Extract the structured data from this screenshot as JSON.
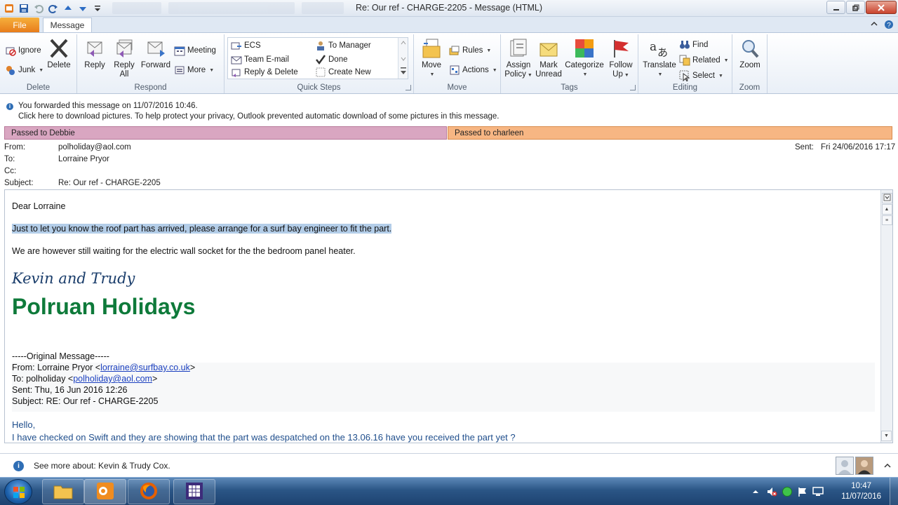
{
  "window": {
    "title": "Re: Our ref - CHARGE-2205  -  Message (HTML)"
  },
  "tabs": {
    "file": "File",
    "message": "Message"
  },
  "ribbon": {
    "delete_group": {
      "label": "Delete",
      "ignore": "Ignore",
      "junk": "Junk",
      "delete": "Delete"
    },
    "respond_group": {
      "label": "Respond",
      "reply": "Reply",
      "reply_all_1": "Reply",
      "reply_all_2": "All",
      "forward": "Forward",
      "meeting": "Meeting",
      "more": "More"
    },
    "quicksteps_group": {
      "label": "Quick Steps",
      "items": [
        "ECS",
        "To Manager",
        "Team E-mail",
        "Done",
        "Reply & Delete",
        "Create New"
      ]
    },
    "move_group": {
      "label": "Move",
      "move": "Move",
      "rules": "Rules",
      "actions": "Actions"
    },
    "tags_group": {
      "label": "Tags",
      "assign_policy_1": "Assign",
      "assign_policy_2": "Policy",
      "mark_unread_1": "Mark",
      "mark_unread_2": "Unread",
      "categorize": "Categorize",
      "follow_up_1": "Follow",
      "follow_up_2": "Up"
    },
    "editing_group": {
      "label": "Editing",
      "translate": "Translate",
      "find": "Find",
      "related": "Related",
      "select": "Select"
    },
    "zoom_group": {
      "label": "Zoom",
      "zoom": "Zoom"
    }
  },
  "info": {
    "forwarded": "You forwarded this message on 11/07/2016 10:46.",
    "pictures": "Click here to download pictures. To help protect your privacy, Outlook prevented automatic download of some pictures in this message."
  },
  "categories": [
    {
      "label": "Passed to Debbie",
      "color": "#d9a6c1"
    },
    {
      "label": "Passed to charleen",
      "color": "#f7b683"
    }
  ],
  "headers": {
    "from_label": "From:",
    "from": "polholiday@aol.com",
    "to_label": "To:",
    "to": "Lorraine Pryor",
    "cc_label": "Cc:",
    "cc": "",
    "subject_label": "Subject:",
    "subject": "Re: Our ref - CHARGE-2205",
    "sent_label": "Sent:",
    "sent": "Fri 24/06/2016 17:17"
  },
  "body": {
    "greeting": "Dear Lorraine",
    "line1": "Just to let you know the roof part has arrived, please arrange for a surf bay engineer to fit the part. ",
    "line2": "We are however still waiting for the electric wall socket for the the bedroom panel heater.",
    "sig_names": "Kevin and Trudy",
    "sig_company": "Polruan Holidays",
    "original_header": "-----Original Message-----",
    "orig_from_prefix": "From: Lorraine Pryor <",
    "orig_from_email": "lorraine@surfbay.co.uk",
    "orig_from_suffix": ">",
    "orig_to_prefix": "To: polholiday <",
    "orig_to_email": "polholiday@aol.com",
    "orig_to_suffix": ">",
    "orig_sent": "Sent: Thu, 16 Jun 2016 12:26",
    "orig_subject": "Subject: RE: Our ref - CHARGE-2205",
    "hello": "Hello,",
    "checked": "I have checked on Swift and they are showing that the part was despatched on the 13.06.16 have you received the part yet ?"
  },
  "people_pane": {
    "text": "See more about: Kevin & Trudy Cox."
  },
  "taskbar": {
    "time": "10:47",
    "date": "11/07/2016"
  }
}
